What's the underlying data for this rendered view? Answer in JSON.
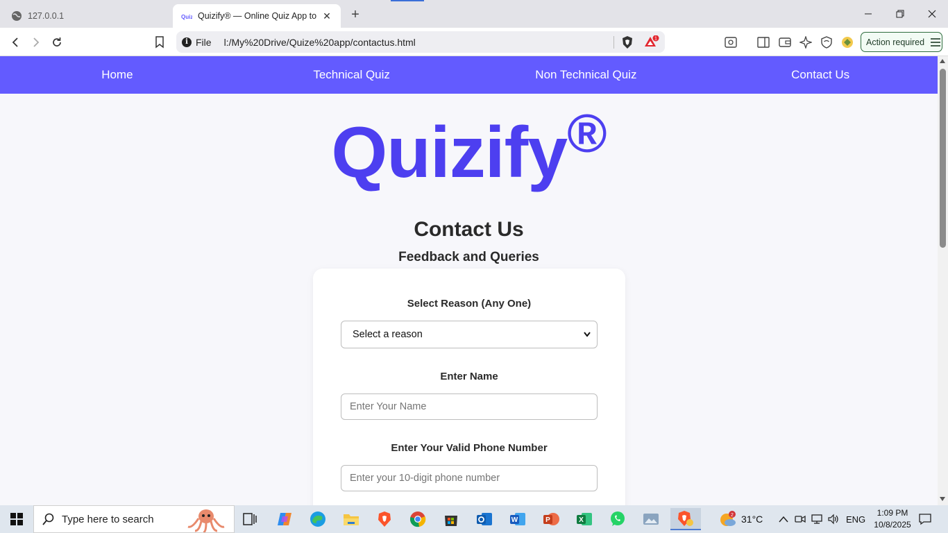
{
  "browser": {
    "tabs": [
      {
        "title": "127.0.0.1",
        "active": false
      },
      {
        "title": "Quizify® — Online Quiz App to",
        "active": true
      }
    ],
    "url_scheme": "File",
    "url": "l:/My%20Drive/Quize%20app/contactus.html",
    "alert_badge": "1",
    "action_required_label": "Action required"
  },
  "navbar": {
    "items": [
      "Home",
      "Technical Quiz",
      "Non Technical Quiz",
      "Contact Us"
    ],
    "background": "#635bff"
  },
  "brand": {
    "name": "Quizify",
    "mark": "®",
    "color": "#4d3ff0"
  },
  "page": {
    "title": "Contact Us",
    "subtitle": "Feedback and Queries"
  },
  "form": {
    "reason_label": "Select Reason (Any One)",
    "reason_selected": "Select a reason",
    "name_label": "Enter Name",
    "name_placeholder": "Enter Your Name",
    "phone_label": "Enter Your Valid Phone Number",
    "phone_placeholder": "Enter your 10-digit phone number"
  },
  "taskbar": {
    "search_placeholder": "Type here to search",
    "apps": [
      "task-view",
      "copilot",
      "edge",
      "file-explorer",
      "brave",
      "chrome",
      "microsoft-store",
      "outlook",
      "word",
      "powerpoint",
      "excel",
      "whatsapp",
      "photos",
      "brave-active"
    ],
    "weather_temp": "31°C",
    "weather_badge": "2",
    "language": "ENG",
    "time": "1:09 PM",
    "date": "10/8/2025"
  }
}
